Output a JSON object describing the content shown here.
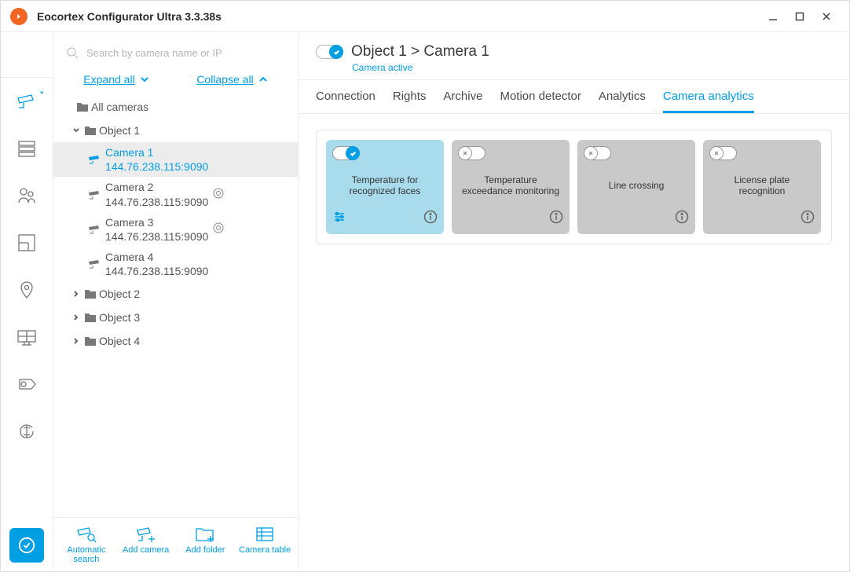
{
  "window": {
    "title": "Eocortex Configurator Ultra 3.3.38s"
  },
  "search": {
    "placeholder": "Search by camera name or IP"
  },
  "expand": {
    "all": "Expand all",
    "collapse": "Collapse all"
  },
  "tree": {
    "root": "All cameras",
    "object1": "Object 1",
    "cam1": {
      "name": "Camera 1",
      "ip": "144.76.238.115:9090"
    },
    "cam2": {
      "name": "Camera 2",
      "ip": "144.76.238.115:9090"
    },
    "cam3": {
      "name": "Camera 3",
      "ip": "144.76.238.115:9090"
    },
    "cam4": {
      "name": "Camera 4",
      "ip": "144.76.238.115:9090"
    },
    "object2": "Object 2",
    "object3": "Object 3",
    "object4": "Object 4"
  },
  "actions": {
    "autosearch": "Automatic search",
    "addcamera": "Add camera",
    "addfolder": "Add folder",
    "cameratable": "Camera table"
  },
  "header": {
    "breadcrumb": "Object 1 > Camera 1",
    "status": "Camera active"
  },
  "tabs": {
    "connection": "Connection",
    "rights": "Rights",
    "archive": "Archive",
    "motion": "Motion detector",
    "analytics": "Analytics",
    "camera_analytics": "Camera analytics"
  },
  "modules": {
    "temp_faces": "Temperature for recognized faces",
    "temp_exc": "Temperature exceedance monitoring",
    "line": "Line crossing",
    "lpr": "License plate recognition"
  }
}
